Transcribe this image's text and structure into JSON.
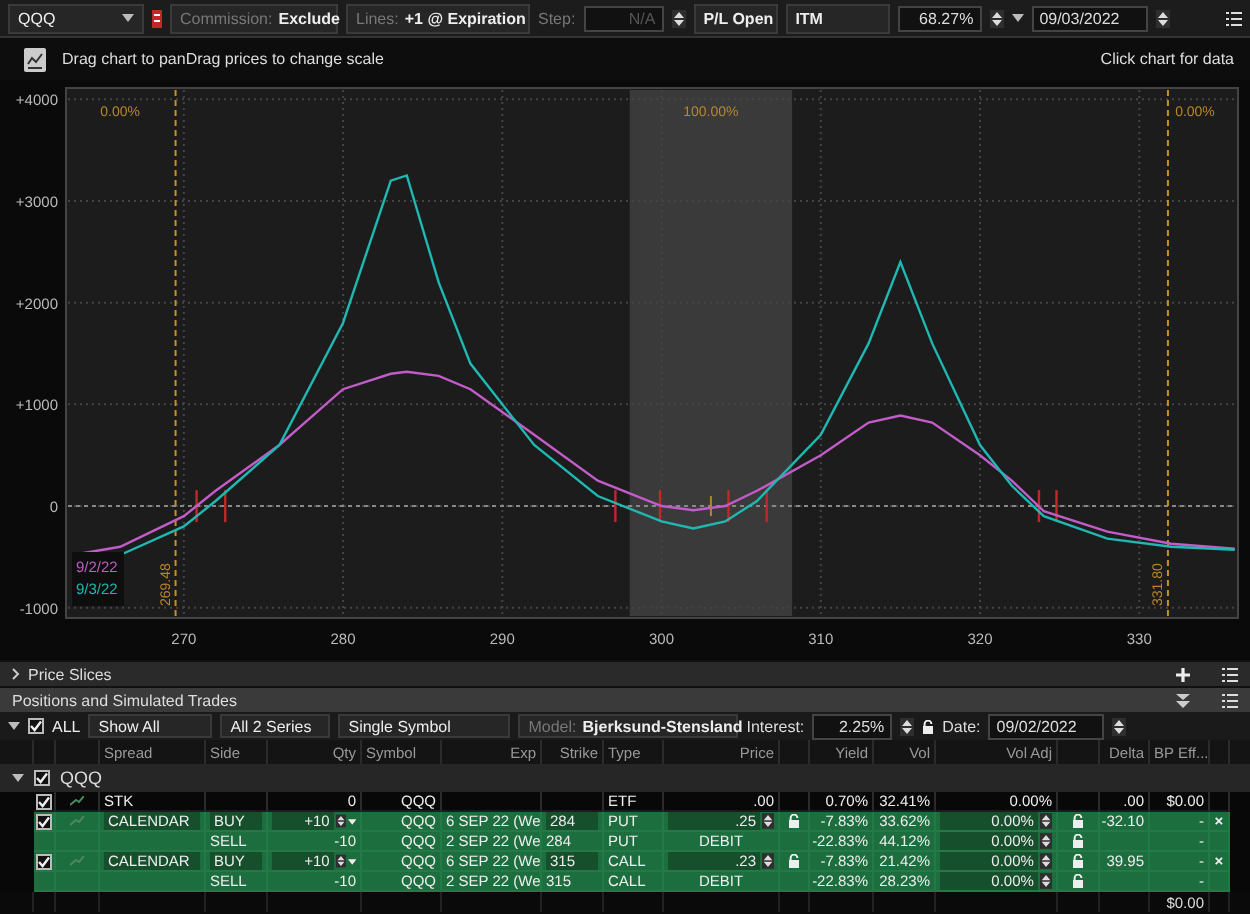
{
  "toolbar": {
    "symbol": "QQQ",
    "commission_label": "Commission:",
    "commission": "Exclude",
    "lines_label": "Lines:",
    "lines": "+1 @ Expiration",
    "step_label": "Step:",
    "step": "N/A",
    "step_disabled": true,
    "pl_mode": "P/L Open",
    "itm": "ITM",
    "probability": "68.27%",
    "date": "09/03/2022"
  },
  "hint_bar": {
    "left": "Drag chart to panDrag prices to change scale",
    "right": "Click chart for data"
  },
  "chart": {
    "probability_labels": [
      "0.00%",
      "100.00%",
      "0.00%"
    ],
    "chart_data": {
      "type": "line",
      "grid": true,
      "x": [
        263,
        266,
        270,
        272,
        276,
        280,
        283,
        284,
        286,
        288,
        292,
        296,
        300,
        302,
        304,
        306,
        310,
        313,
        315,
        317,
        320,
        322,
        324,
        328,
        332,
        336
      ],
      "series": [
        {
          "name": "9/2/22",
          "color": "#c25cc8",
          "values": [
            -480,
            -400,
            -100,
            150,
            600,
            1150,
            1300,
            1320,
            1280,
            1150,
            700,
            250,
            0,
            -40,
            0,
            150,
            500,
            820,
            890,
            820,
            500,
            250,
            -50,
            -250,
            -370,
            -420
          ]
        },
        {
          "name": "9/3/22",
          "color": "#1fb8b2",
          "values": [
            null,
            -480,
            -200,
            50,
            600,
            1800,
            3200,
            3250,
            2200,
            1400,
            600,
            100,
            -150,
            -220,
            -150,
            50,
            700,
            1600,
            2400,
            1600,
            600,
            200,
            -100,
            -320,
            -400,
            -430
          ]
        }
      ],
      "xlim": [
        262.6,
        336.2
      ],
      "ylim": [
        -1100,
        4110
      ],
      "xticks": [
        270,
        280,
        290,
        300,
        310,
        320,
        330
      ],
      "yticks": [
        {
          "value": 4000,
          "label": "+4000"
        },
        {
          "value": 3000,
          "label": "+3000"
        },
        {
          "value": 2000,
          "label": "+2000"
        },
        {
          "value": 1000,
          "label": "+1000"
        },
        {
          "value": 0,
          "label": "0"
        },
        {
          "value": -1000,
          "label": "-1000"
        }
      ],
      "ref_lines": [
        {
          "axis": "y",
          "value": 0
        },
        {
          "axis": "x",
          "value": 269.48,
          "label": "269.48"
        },
        {
          "axis": "x",
          "value": 331.8,
          "label": "331.80"
        }
      ],
      "bands": [
        {
          "axis": "x",
          "from": 298,
          "to": 308.2
        }
      ]
    }
  },
  "sections": [
    {
      "title": "Price Slices",
      "expanded": false
    },
    {
      "title": "Positions and Simulated Trades",
      "expanded": true
    }
  ],
  "positions_toolbar": {
    "all_checked": true,
    "all_label": "ALL",
    "filter": "Show All",
    "series": "All 2 Series",
    "symbol_mode": "Single Symbol",
    "model_label": "Model:",
    "model": "Bjerksund-Stensland",
    "interest_label": "Interest:",
    "interest": "2.25%",
    "date_label": "Date:",
    "date": "09/02/2022"
  },
  "table": {
    "columns": [
      "Spread",
      "Side",
      "Qty",
      "Symbol",
      "Exp",
      "Strike",
      "Type",
      "Price",
      "Yield",
      "Vol",
      "Vol Adj",
      "Delta",
      "BP Eff..."
    ],
    "group": {
      "name": "QQQ",
      "checked": true,
      "expanded": true
    },
    "rows": [
      {
        "kind": "stock",
        "checked": true,
        "spread": "STK",
        "qty": "0",
        "symbol": "QQQ",
        "type": "ETF",
        "price": ".00",
        "yield": "0.70%",
        "vol": "32.41%",
        "vol_adj": "0.00%",
        "delta": ".00",
        "bp": "$0.00"
      },
      {
        "kind": "buy",
        "checked": true,
        "spread": "CALENDAR",
        "side": "BUY",
        "qty": "+10",
        "symbol": "QQQ",
        "exp": "6 SEP 22 (We",
        "strike": "284",
        "type": "PUT",
        "price": ".25",
        "yield": "-7.83%",
        "vol": "33.62%",
        "vol_adj": "0.00%",
        "delta": "-32.10",
        "bp": "-",
        "remove": "×"
      },
      {
        "kind": "sell",
        "side": "SELL",
        "qty": "-10",
        "symbol": "QQQ",
        "exp": "2 SEP 22 (We",
        "strike": "284",
        "type": "PUT",
        "price": "DEBIT",
        "yield": "-22.83%",
        "vol": "44.12%",
        "vol_adj": "0.00%",
        "bp": "-"
      },
      {
        "kind": "buy",
        "checked": true,
        "spread": "CALENDAR",
        "side": "BUY",
        "qty": "+10",
        "symbol": "QQQ",
        "exp": "6 SEP 22 (We",
        "strike": "315",
        "type": "CALL",
        "price": ".23",
        "yield": "-7.83%",
        "vol": "21.42%",
        "vol_adj": "0.00%",
        "delta": "39.95",
        "bp": "-",
        "remove": "×"
      },
      {
        "kind": "sell",
        "side": "SELL",
        "qty": "-10",
        "symbol": "QQQ",
        "exp": "2 SEP 22 (We",
        "strike": "315",
        "type": "CALL",
        "price": "DEBIT",
        "yield": "-22.83%",
        "vol": "28.23%",
        "vol_adj": "0.00%",
        "bp": "-"
      }
    ],
    "total": "$0.00"
  }
}
